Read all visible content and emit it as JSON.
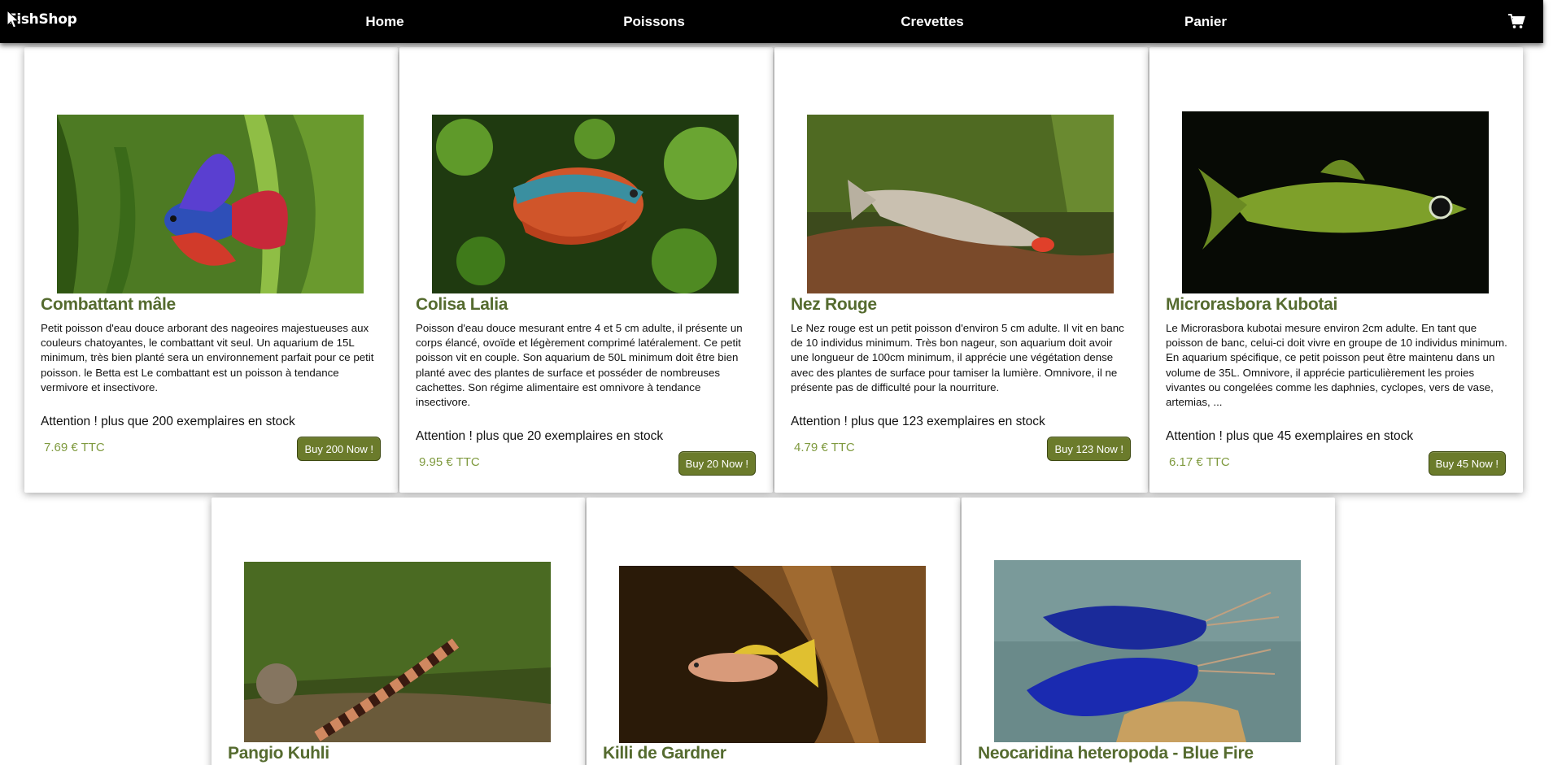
{
  "nav": {
    "brand": "FishShop",
    "links": [
      "Home",
      "Poissons",
      "Crevettes",
      "Panier"
    ],
    "cart_icon": "cart-icon"
  },
  "products": [
    {
      "name": "Combattant mâle",
      "description": "Petit poisson d'eau douce arborant des nageoires majestueuses aux couleurs chatoyantes, le combattant vit seul. Un aquarium de 15L minimum, très bien planté sera un environnement parfait pour ce petit poisson. le Betta est Le combattant est un poisson à tendance vermivore et insectivore.",
      "stock": "Attention ! plus que 200 exemplaires en stock",
      "price": "7.69 € TTC",
      "button": "Buy 200 Now !"
    },
    {
      "name": "Colisa Lalia",
      "description": "Poisson d'eau douce mesurant entre 4 et 5 cm adulte, il présente un corps élancé, ovoïde et légèrement comprimé latéralement. Ce petit poisson vit en couple. Son aquarium de 50L minimum doit être bien planté avec des plantes de surface et posséder de nombreuses cachettes. Son régime alimentaire est omnivore à tendance insectivore.",
      "stock": "Attention ! plus que 20 exemplaires en stock",
      "price": "9.95 € TTC",
      "button": "Buy 20 Now !"
    },
    {
      "name": "Nez Rouge",
      "description": "Le Nez rouge est un petit poisson d'environ 5 cm adulte. Il vit en banc de 10 individus minimum. Très bon nageur, son aquarium doit avoir une longueur de 100cm minimum, il apprécie une végétation dense avec des plantes de surface pour tamiser la lumière. Omnivore, il ne présente pas de difficulté pour la nourriture.",
      "stock": "Attention ! plus que 123 exemplaires en stock",
      "price": "4.79 € TTC",
      "button": "Buy 123 Now !"
    },
    {
      "name": "Microrasbora Kubotai",
      "description": "Le Microrasbora kubotai mesure environ 2cm adulte. En tant que poisson de banc, celui-ci doit vivre en groupe de 10 individus minimum. En aquarium spécifique, ce petit poisson peut être maintenu dans un volume de 35L. Omnivore, il apprécie particulièrement les proies vivantes ou congelées comme les daphnies, cyclopes, vers de vase, artemias, ...",
      "stock": "Attention ! plus que 45 exemplaires en stock",
      "price": "6.17 € TTC",
      "button": "Buy 45 Now !"
    },
    {
      "name": "Pangio Kuhli"
    },
    {
      "name": "Killi de Gardner"
    },
    {
      "name": "Neocaridina heteropoda - Blue Fire"
    }
  ]
}
